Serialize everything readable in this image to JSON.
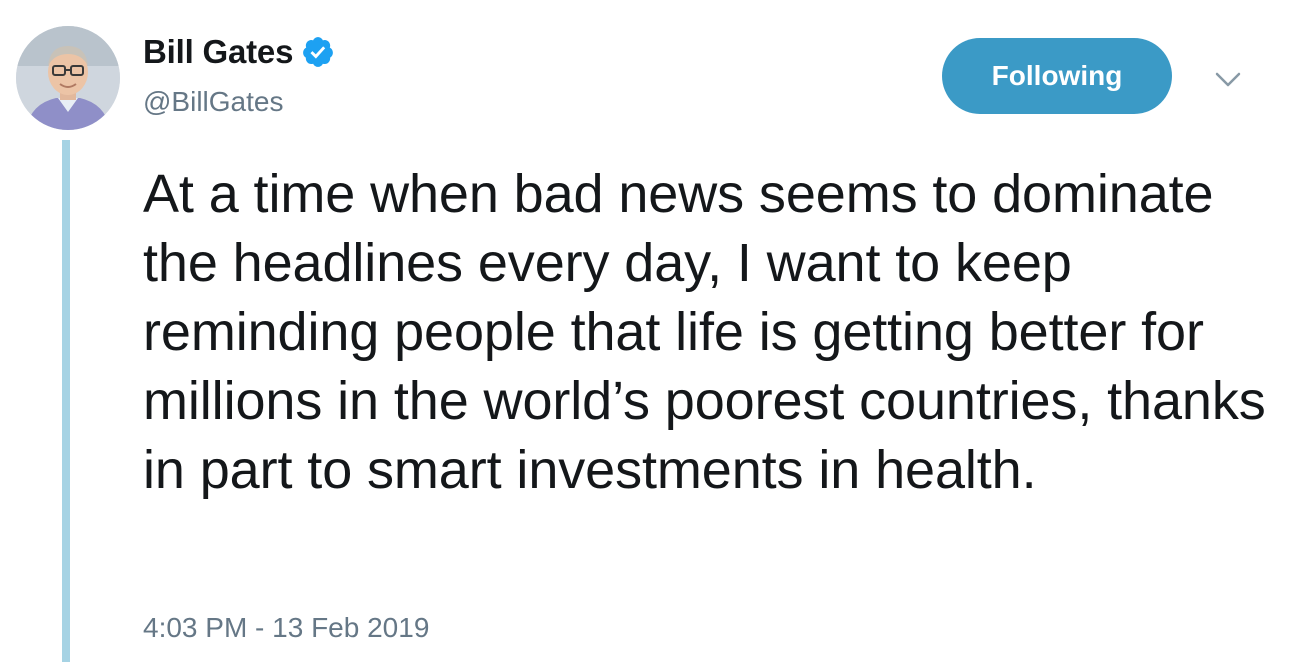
{
  "author": {
    "display_name": "Bill Gates",
    "handle": "@BillGates",
    "verified": true,
    "verified_icon": "verified-badge-icon",
    "avatar_icon": "profile-photo"
  },
  "actions": {
    "follow_label": "Following",
    "more_icon": "chevron-down-icon"
  },
  "tweet": {
    "text": "At a time when bad news seems to dominate the headlines every day, I want to keep reminding people that life is getting better for millions in the world’s poorest countries, thanks in part to smart investments in health.",
    "timestamp": "4:03 PM - 13 Feb 2019"
  },
  "colors": {
    "accent": "#1da1f2",
    "following_button": "#3b9ac6",
    "thread_line": "#a6d3e4",
    "secondary_text": "#657786"
  }
}
